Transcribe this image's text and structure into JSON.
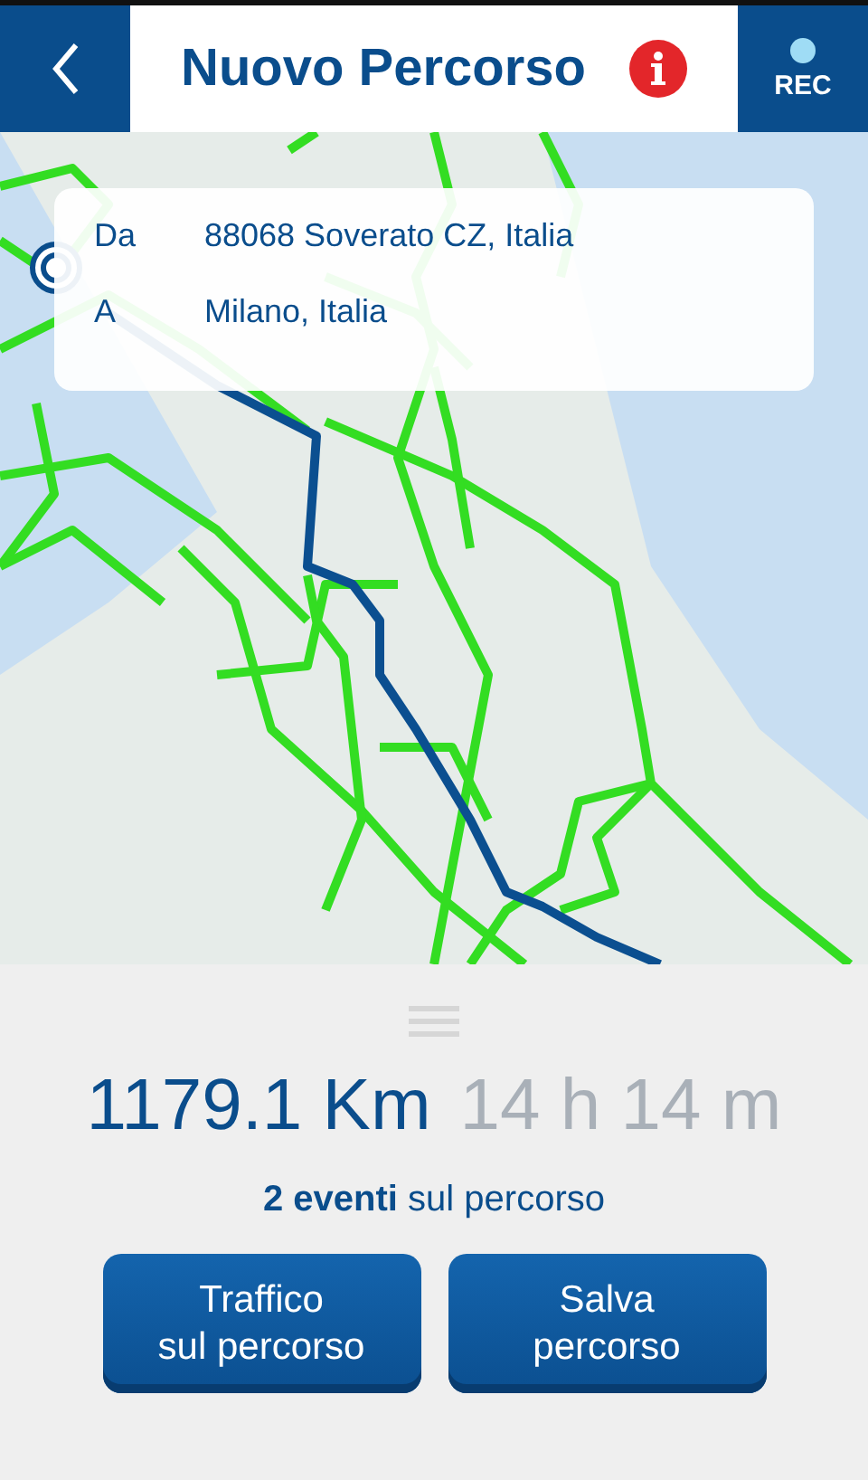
{
  "header": {
    "title": "Nuovo Percorso",
    "rec_label": "REC"
  },
  "route_card": {
    "rows": [
      {
        "label": "Da",
        "value": "88068 Soverato CZ, Italia"
      },
      {
        "label": "A",
        "value": "Milano, Italia"
      }
    ]
  },
  "summary": {
    "distance": "1179.1 Km",
    "duration": "14 h 14 m",
    "events": "**2 eventi** sul percorso"
  },
  "buttons": [
    "Traffico\nsul percorso",
    "Salva\npercorso"
  ]
}
